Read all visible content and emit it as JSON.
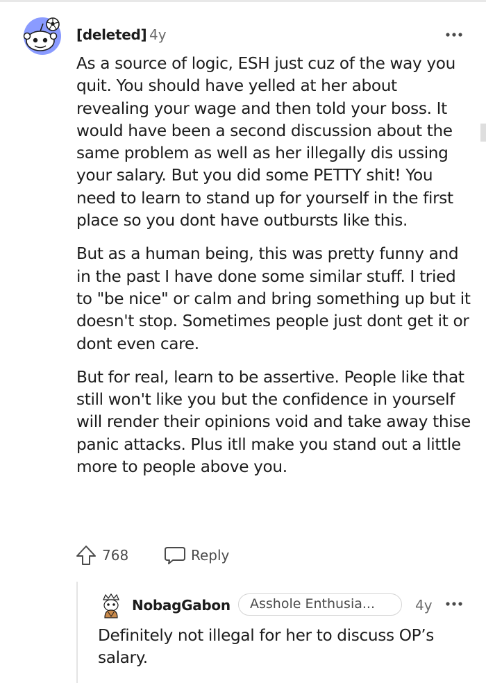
{
  "comment": {
    "username": "[deleted]",
    "age": "4y",
    "avatar_icon": "snoo-avatar-icon",
    "more_icon": "more-options-icon",
    "paragraphs": [
      "As a source of logic, ESH just cuz of the way you quit. You should have yelled at her about revealing your wage and then told your boss. It would have been a second discussion about the same problem as well as her illegally dis ussing your salary. But you did some PETTY shit! You need to learn to stand up for yourself in the first place so you dont have outbursts like this.",
      "But as a human being, this was pretty funny and in the past I have done some similar stuff. I tried to \"be nice\" or calm and bring something up but it doesn't stop. Sometimes people just dont get it or dont even care.",
      "But for real, learn to be assertive. People like that still won't like you but the confidence in yourself will render their opinions void and take away thise panic attacks. Plus itll make you stand out a little more to people above you."
    ],
    "score": "768",
    "reply_label": "Reply",
    "upvote_icon": "upvote-arrow-icon",
    "reply_icon": "comment-bubble-icon"
  },
  "reply": {
    "username": "NobagGabon",
    "flair": "Asshole Enthusia...",
    "age": "4y",
    "avatar_icon": "user-avatar-icon",
    "more_icon": "more-options-icon",
    "body": "Definitely not illegal for her to discuss OP’s salary."
  },
  "colors": {
    "avatar_bg": "#7e8eff",
    "text": "#1c1c1c",
    "muted": "#6b6b6b"
  }
}
